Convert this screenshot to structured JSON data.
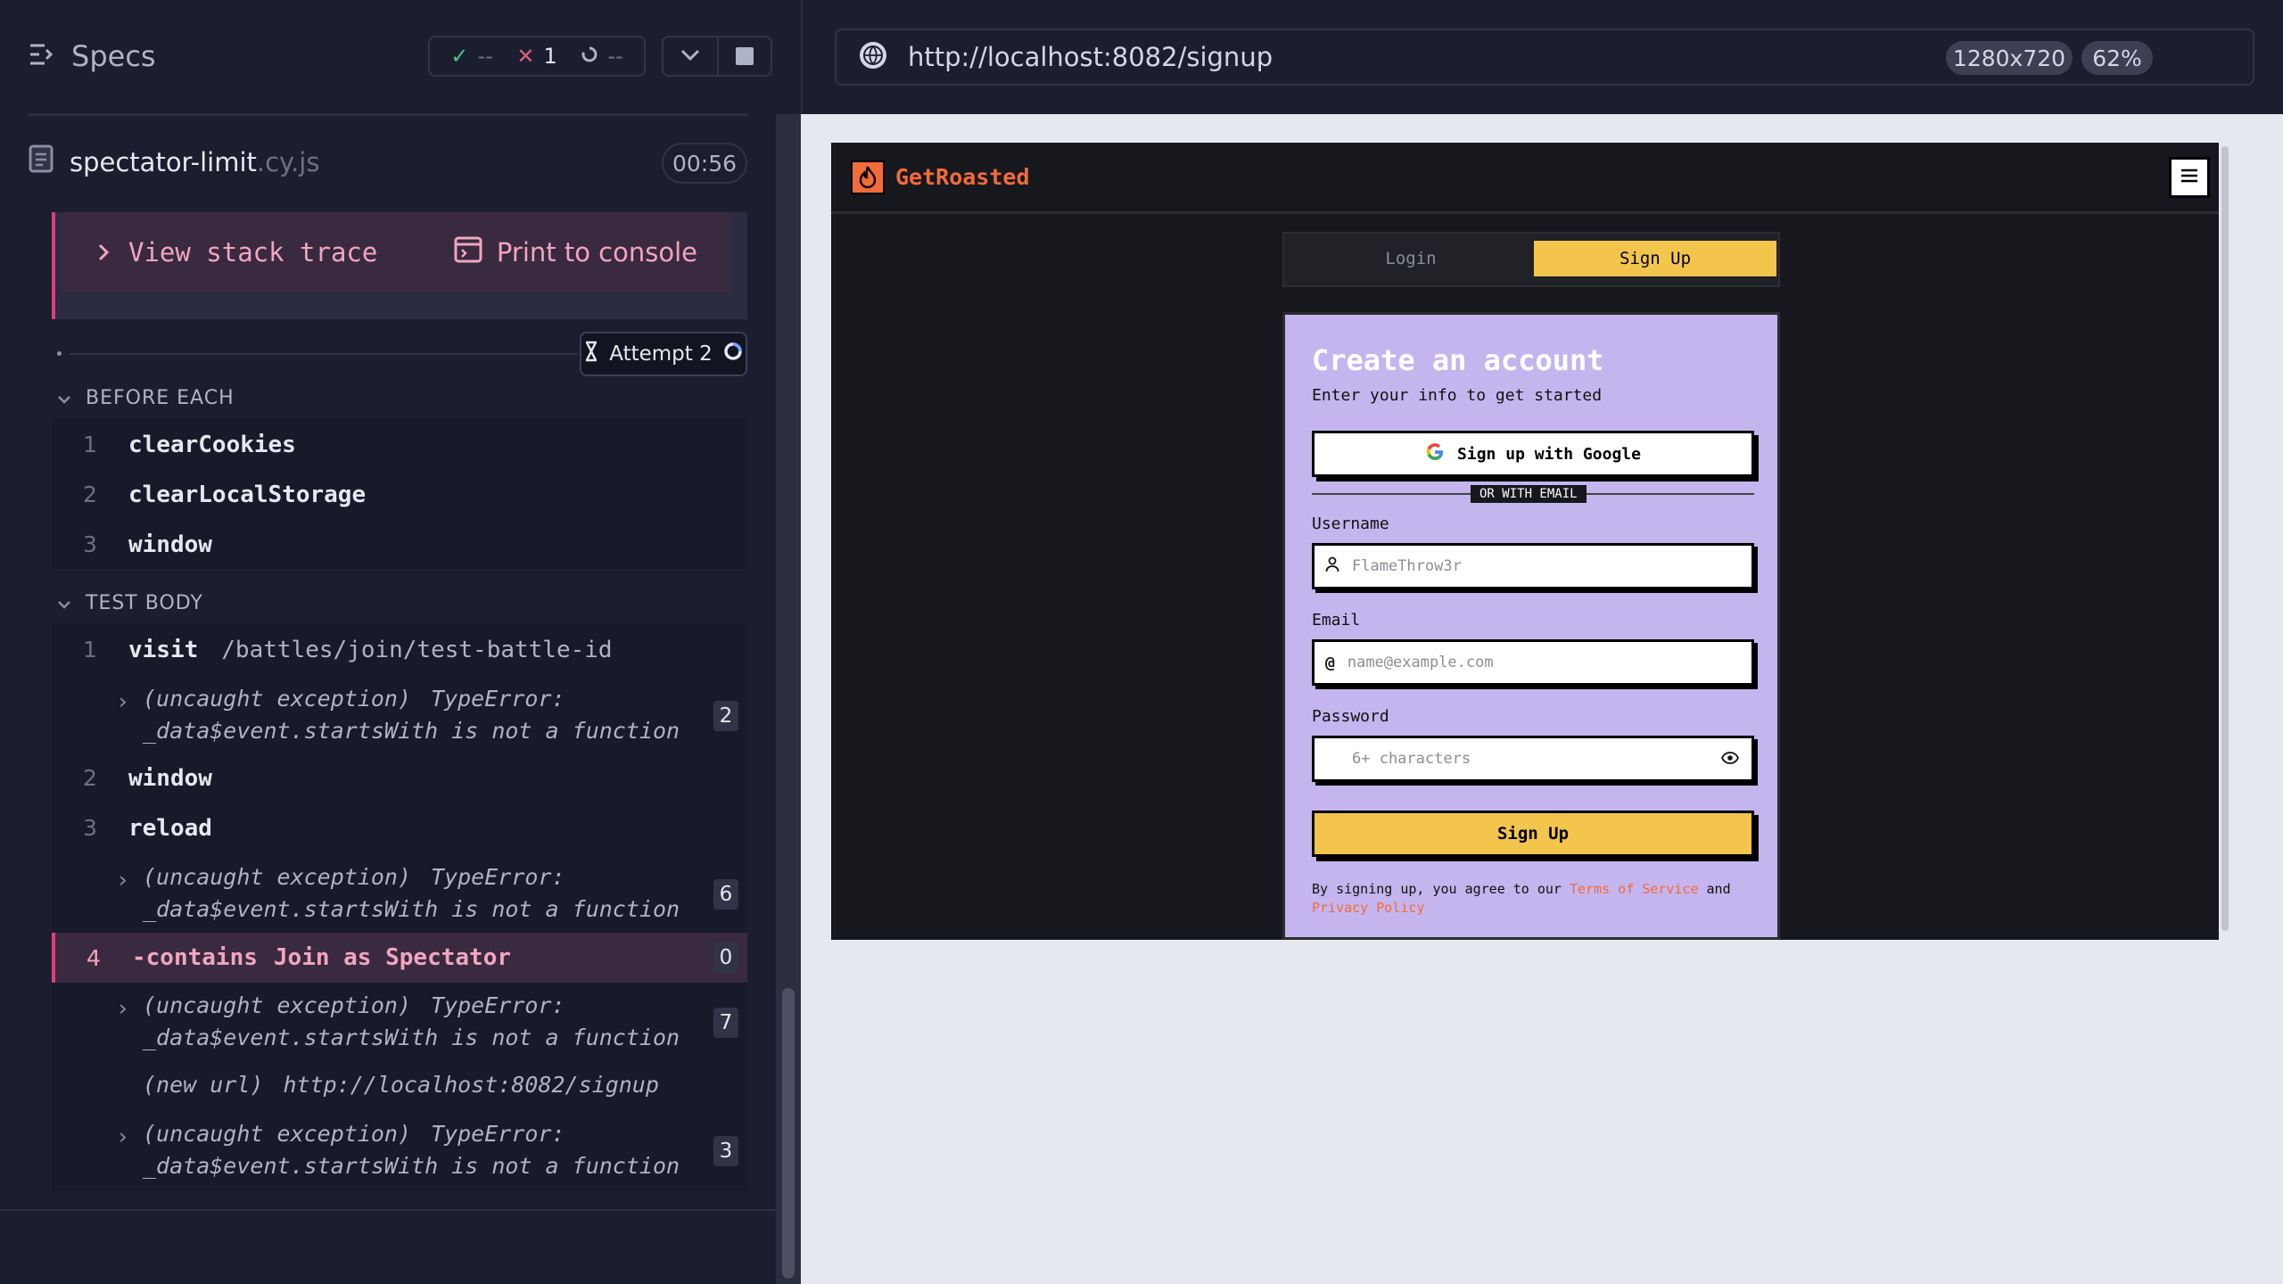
{
  "reporter": {
    "specs_label": "Specs",
    "stats": {
      "passed": "--",
      "failed": "1",
      "pending": "--"
    },
    "spec_name": "spectator-limit",
    "spec_ext": ".cy.js",
    "timer": "00:56",
    "error": {
      "stack_label": "View stack trace",
      "print_label": "Print to console"
    },
    "attempt": "Attempt 2",
    "before_each": {
      "title": "BEFORE EACH",
      "commands": [
        {
          "num": "1",
          "name": "clearCookies"
        },
        {
          "num": "2",
          "name": "clearLocalStorage"
        },
        {
          "num": "3",
          "name": "window"
        }
      ]
    },
    "test_body": {
      "title": "TEST BODY",
      "visit": {
        "num": "1",
        "name": "visit",
        "arg": "/battles/join/test-battle-id"
      },
      "exc1": {
        "kind": "(uncaught exception)",
        "type": "TypeError:",
        "msg": "_data$event.startsWith is not a function",
        "count": "2"
      },
      "window": {
        "num": "2",
        "name": "window"
      },
      "reload": {
        "num": "3",
        "name": "reload"
      },
      "exc2": {
        "kind": "(uncaught exception)",
        "type": "TypeError:",
        "msg": "_data$event.startsWith is not a function",
        "count": "6"
      },
      "contains": {
        "num": "4",
        "name": "-contains",
        "arg": "Join as Spectator",
        "count": "0"
      },
      "exc3": {
        "kind": "(uncaught exception)",
        "type": "TypeError:",
        "msg": "_data$event.startsWith is not a function",
        "count": "7"
      },
      "new_url": {
        "kind": "(new url)",
        "url": "http://localhost:8082/signup"
      },
      "exc4": {
        "kind": "(uncaught exception)",
        "type": "TypeError:",
        "msg": "_data$event.startsWith is not a function",
        "count": "3"
      }
    }
  },
  "runner": {
    "url": "http://localhost:8082/signup",
    "viewport": "1280x720",
    "zoom": "62%"
  },
  "app": {
    "brand": "GetRoasted",
    "tabs": {
      "login": "Login",
      "signup": "Sign Up"
    },
    "card": {
      "title": "Create an account",
      "subtitle": "Enter your info to get started",
      "google_btn": "Sign up with Google",
      "divider": "OR WITH EMAIL",
      "username_label": "Username",
      "username_placeholder": "FlameThrow3r",
      "email_label": "Email",
      "email_placeholder": "name@example.com",
      "password_label": "Password",
      "password_placeholder": "6+ characters",
      "submit": "Sign Up",
      "terms_prefix": "By signing up, you agree to our",
      "terms_link": "Terms of Service",
      "terms_and": "and",
      "privacy_link": "Privacy Policy"
    }
  },
  "colors": {
    "accent": "#f3c54d",
    "brand": "#f26b3a",
    "card": "#c4b5ef",
    "error": "#d2467a"
  }
}
